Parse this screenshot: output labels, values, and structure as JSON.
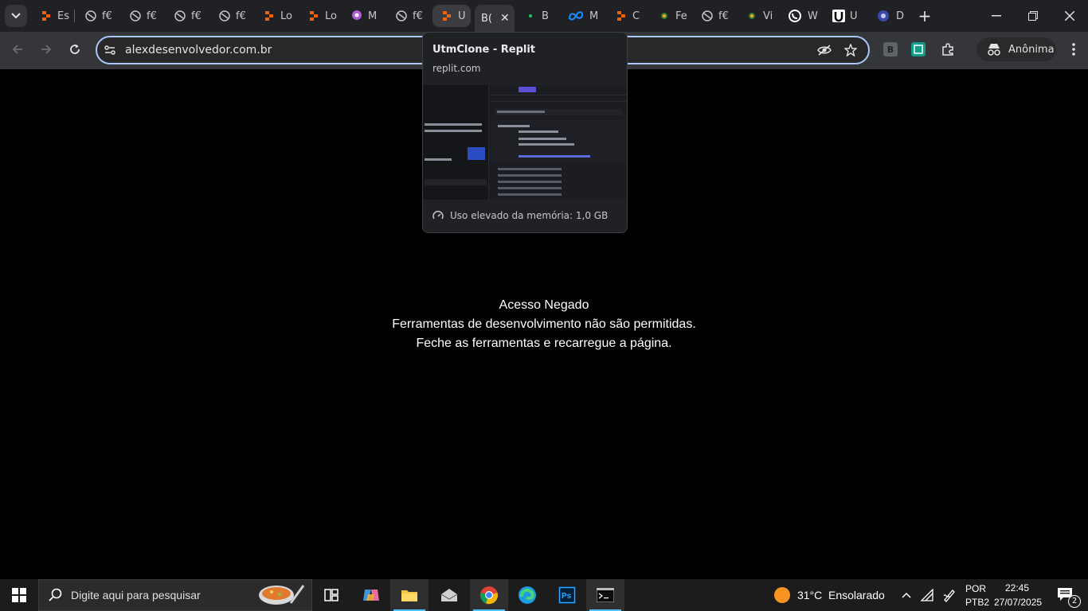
{
  "browser": {
    "tabs": [
      {
        "label": "Es",
        "icon": "replit-icon"
      },
      {
        "label": "f€",
        "icon": "globe-icon"
      },
      {
        "label": "f€",
        "icon": "globe-icon"
      },
      {
        "label": "f€",
        "icon": "globe-icon"
      },
      {
        "label": "f€",
        "icon": "globe-icon"
      },
      {
        "label": "Lo",
        "icon": "replit-icon"
      },
      {
        "label": "Lo",
        "icon": "replit-icon"
      },
      {
        "label": "M",
        "icon": "pin-icon"
      },
      {
        "label": "f€",
        "icon": "globe-icon"
      },
      {
        "label": "U",
        "icon": "replit-icon"
      },
      {
        "label": "B(",
        "icon": "none"
      },
      {
        "label": "B",
        "icon": "dot-icon"
      },
      {
        "label": "M",
        "icon": "meta-icon"
      },
      {
        "label": "C",
        "icon": "replit-icon"
      },
      {
        "label": "Fe",
        "icon": "green-dot-icon"
      },
      {
        "label": "f€",
        "icon": "globe-icon"
      },
      {
        "label": "Vi",
        "icon": "green-dot-icon"
      },
      {
        "label": "W",
        "icon": "whatsapp-icon"
      },
      {
        "label": "U",
        "icon": "u-icon"
      },
      {
        "label": "D",
        "icon": "d-icon"
      }
    ],
    "address": "alexdesenvolvedor.com.br",
    "incognito_label": "Anônima",
    "hover_card": {
      "title": "UtmClone - Replit",
      "domain": "replit.com",
      "memory": "Uso elevado da memória: 1,0 GB"
    },
    "extensions": [
      "B"
    ]
  },
  "page": {
    "line1": "Acesso Negado",
    "line2": "Ferramentas de desenvolvimento não são permitidas.",
    "line3": "Feche as ferramentas e recarregue a página."
  },
  "taskbar": {
    "search_placeholder": "Digite aqui para pesquisar",
    "weather_temp": "31°C",
    "weather_desc": "Ensolarado",
    "lang": "POR",
    "layout": "PTB2",
    "time": "22:45",
    "date": "27/07/2025",
    "notifications": "2"
  },
  "colors": {
    "accent": "#a8c7fa",
    "replit_orange": "#f26207",
    "taskbar_active": "#4cc2ff"
  }
}
